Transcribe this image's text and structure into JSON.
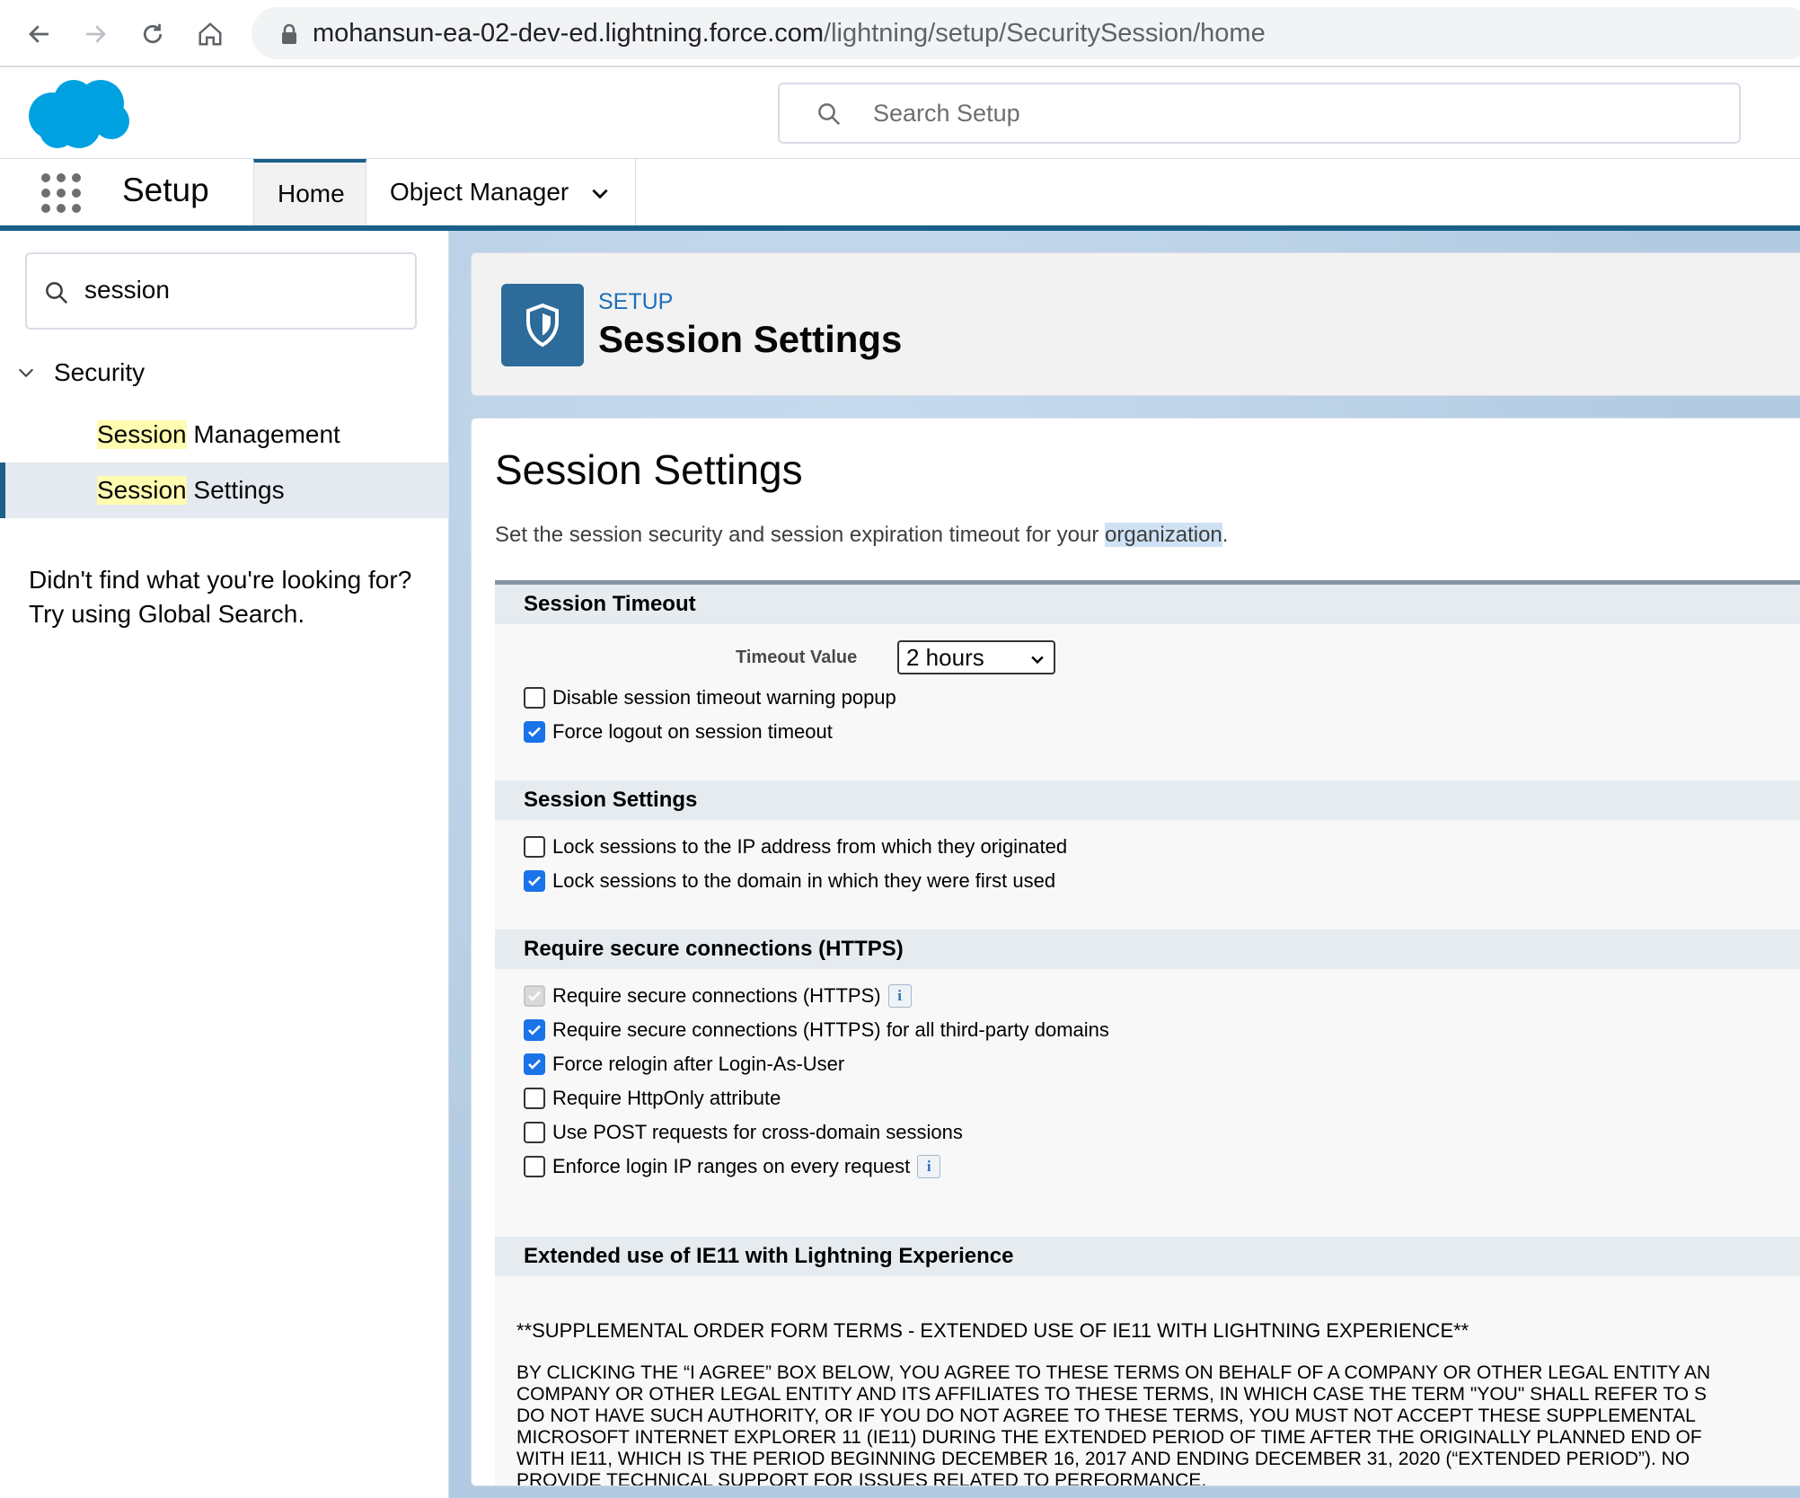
{
  "browser": {
    "url_host": "mohansun-ea-02-dev-ed.lightning.force.com",
    "url_path": "/lightning/setup/SecuritySession/home"
  },
  "header": {
    "search_placeholder": "Search Setup"
  },
  "context_bar": {
    "app_name": "Setup",
    "tabs": [
      {
        "label": "Home"
      },
      {
        "label": "Object Manager"
      }
    ]
  },
  "sidebar": {
    "quick_find_value": "session",
    "group_label": "Security",
    "items": [
      {
        "highlight": "Session",
        "rest": " Management"
      },
      {
        "highlight": "Session",
        "rest": " Settings"
      }
    ],
    "notfound_line1": "Didn't find what you're looking for?",
    "notfound_line2": "Try using Global Search."
  },
  "page_header": {
    "eyebrow": "SETUP",
    "title": "Session Settings"
  },
  "content": {
    "title": "Session Settings",
    "desc_prefix": "Set the session security and session expiration timeout for your ",
    "desc_highlight": "organization",
    "desc_suffix": "."
  },
  "session_timeout": {
    "header": "Session Timeout",
    "timeout_label": "Timeout Value",
    "timeout_value": "2 hours",
    "options": [
      {
        "label": "Disable session timeout warning popup",
        "checked": false
      },
      {
        "label": "Force logout on session timeout",
        "checked": true
      }
    ]
  },
  "session_settings": {
    "header": "Session Settings",
    "options": [
      {
        "label": "Lock sessions to the IP address from which they originated",
        "checked": false
      },
      {
        "label": "Lock sessions to the domain in which they were first used",
        "checked": true
      }
    ]
  },
  "https": {
    "header": "Require secure connections (HTTPS)",
    "options": [
      {
        "label": "Require secure connections (HTTPS)",
        "checked": true,
        "disabled": true,
        "info": "i"
      },
      {
        "label": "Require secure connections (HTTPS) for all third-party domains",
        "checked": true
      },
      {
        "label": "Force relogin after Login-As-User",
        "checked": true
      },
      {
        "label": "Require HttpOnly attribute",
        "checked": false
      },
      {
        "label": "Use POST requests for cross-domain sessions",
        "checked": false
      },
      {
        "label": "Enforce login IP ranges on every request",
        "checked": false,
        "info": "i"
      }
    ]
  },
  "ie11": {
    "header": "Extended use of IE11 with Lightning Experience",
    "terms_title": "**SUPPLEMENTAL ORDER FORM TERMS - EXTENDED USE OF IE11 WITH LIGHTNING EXPERIENCE**",
    "terms_lines": [
      "BY CLICKING THE “I AGREE” BOX BELOW, YOU AGREE TO THESE TERMS ON BEHALF OF A COMPANY OR OTHER LEGAL ENTITY AN",
      "COMPANY OR OTHER LEGAL ENTITY AND ITS AFFILIATES TO THESE TERMS, IN WHICH CASE THE TERM \"YOU\" SHALL REFER TO S",
      "DO NOT HAVE SUCH AUTHORITY, OR IF YOU DO NOT AGREE TO THESE TERMS, YOU MUST NOT ACCEPT THESE SUPPLEMENTAL",
      "MICROSOFT INTERNET EXPLORER 11 (IE11) DURING THE EXTENDED PERIOD OF TIME AFTER THE ORIGINALLY PLANNED END OF",
      "WITH IE11, WHICH IS THE PERIOD BEGINNING DECEMBER 16, 2017 AND ENDING DECEMBER 31, 2020 (“EXTENDED PERIOD”). NO",
      "PROVIDE TECHNICAL SUPPORT FOR ISSUES RELATED TO PERFORMANCE."
    ]
  },
  "colors": {
    "brand": "#1b5f8a",
    "checkbox_checked": "#1a73e8",
    "link": "#1b6fbb"
  }
}
